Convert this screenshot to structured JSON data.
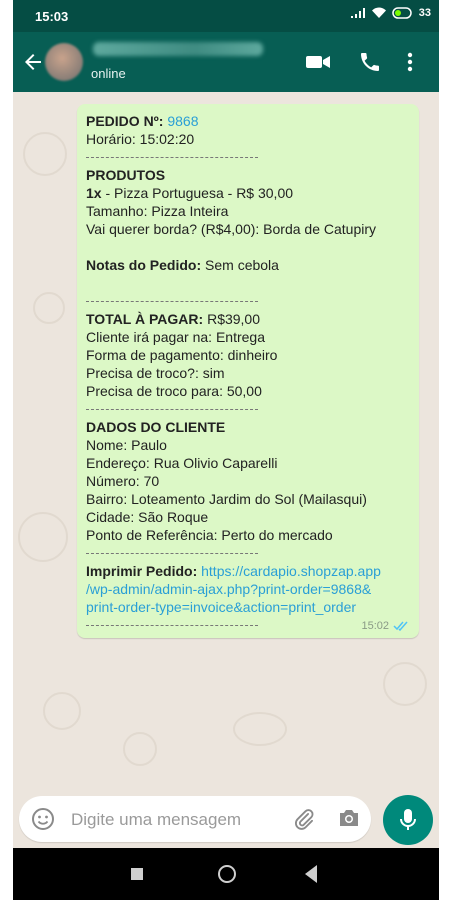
{
  "status_bar": {
    "time": "15:03",
    "battery": "33"
  },
  "header": {
    "contact_status": "online"
  },
  "message": {
    "order_label": "PEDIDO Nº:",
    "order_number": "9868",
    "time_line": "Horário: 15:02:20",
    "products_title": "PRODUTOS",
    "product_qty": "1x",
    "product_line": " - Pizza Portuguesa - R$ 30,00",
    "size_line": "Tamanho: Pizza Inteira",
    "crust_line": "Vai querer borda? (R$4,00): Borda de Catupiry",
    "notes_label": "Notas do Pedido:",
    "notes_value": " Sem cebola",
    "total_label": "TOTAL À PAGAR:",
    "total_value": " R$39,00",
    "pay_where": "Cliente irá pagar na: Entrega",
    "pay_method": "Forma de pagamento: dinheiro",
    "change_needed": "Precisa de troco?: sim",
    "change_for": "Precisa de troco para: 50,00",
    "client_title": "DADOS DO CLIENTE",
    "name": "Nome: Paulo",
    "address": "Endereço: Rua Olivio Caparelli",
    "number": "Número: 70",
    "district": "Bairro: Loteamento Jardim do Sol (Mailasqui)",
    "city": "Cidade: São Roque",
    "reference": "Ponto de Referência: Perto do mercado",
    "print_label": "Imprimir Pedido:",
    "link_1": " https://cardapio.shopzap.app",
    "link_2": "/wp-admin/admin-ajax.php?print-order=9868&",
    "link_3": "print-order-type=invoice&action=print_order",
    "timestamp": "15:02"
  },
  "composer": {
    "placeholder": "Digite uma mensagem"
  },
  "colors": {
    "header": "#075e54",
    "bubble": "#dcf8c6",
    "accent": "#00897b",
    "link": "#2a9fd6"
  }
}
